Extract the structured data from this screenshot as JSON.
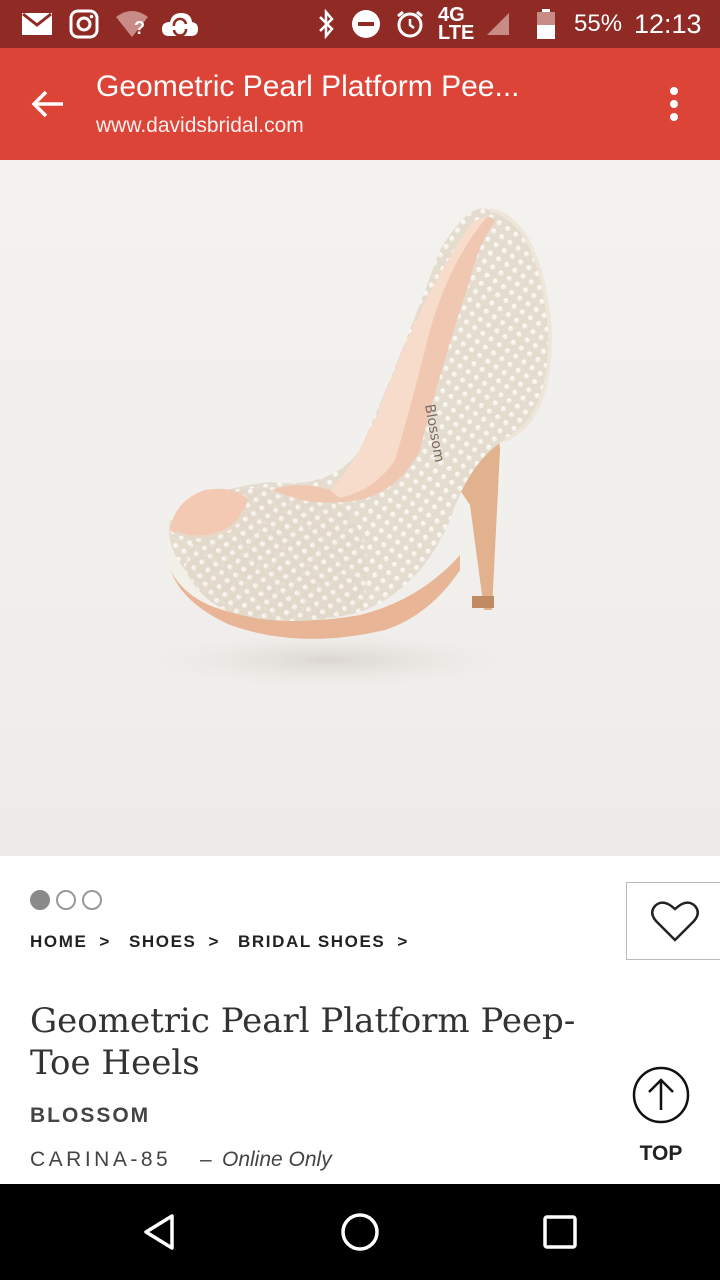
{
  "status_bar": {
    "battery_percent": "55%",
    "time": "12:13",
    "network": "4G LTE",
    "wifi_badge": "?",
    "icons": [
      "mail-icon",
      "instagram-icon",
      "wifi-icon",
      "cloud-sync-icon",
      "bluetooth-icon",
      "do-not-disturb-icon",
      "alarm-icon",
      "network-icon",
      "signal-icon",
      "battery-icon"
    ]
  },
  "app_bar": {
    "title": "Geometric Pearl Platform Pee...",
    "url": "www.davidsbridal.com",
    "color": "#dc4437"
  },
  "gallery": {
    "image_alt": "Geometric Pearl Platform Peep-Toe Heel",
    "count": 3,
    "active_index": 0
  },
  "breadcrumb": {
    "items": [
      "HOME",
      "SHOES",
      "BRIDAL SHOES"
    ],
    "separator": ">"
  },
  "product": {
    "title": "Geometric Pearl Platform Peep-Toe Heels",
    "brand": "BLOSSOM",
    "sku": "CARINA-85",
    "dash": "–",
    "availability": "Online Only"
  },
  "actions": {
    "top_label": "TOP"
  }
}
